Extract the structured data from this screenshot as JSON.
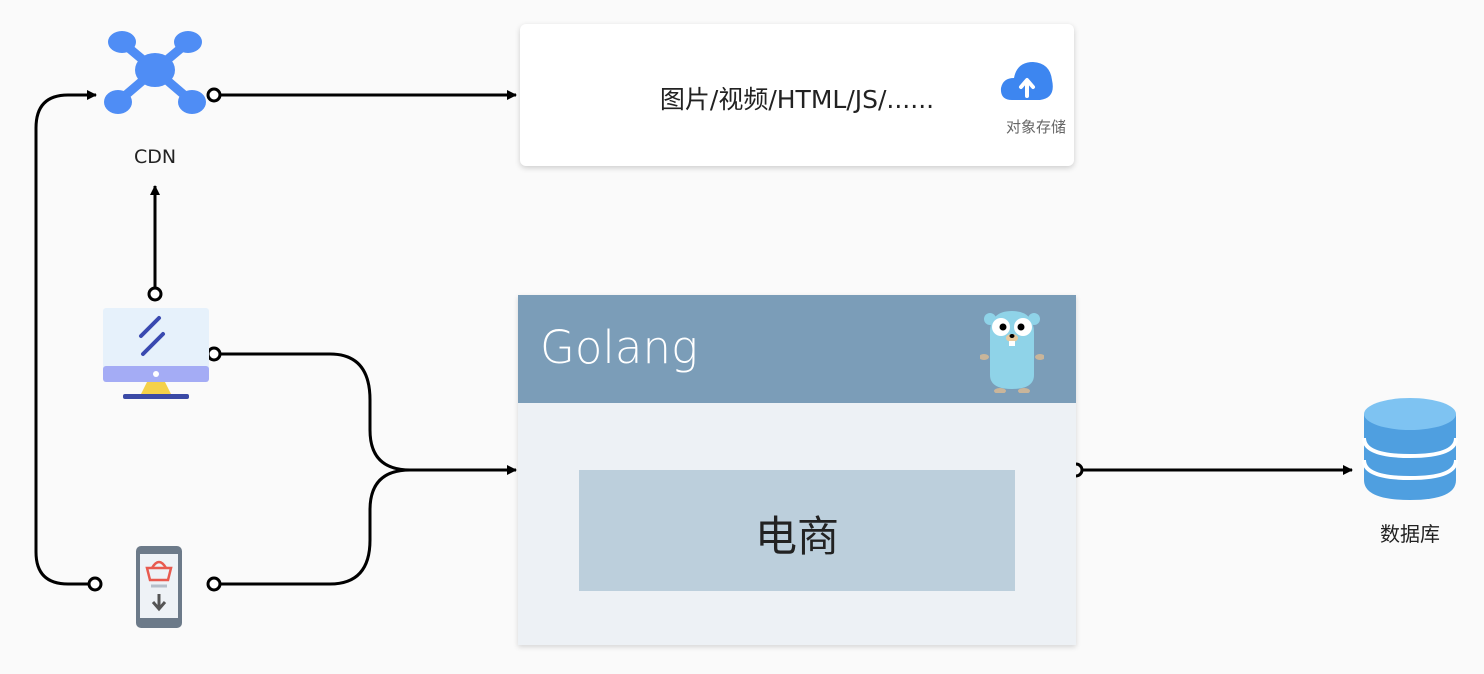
{
  "nodes": {
    "cdn": {
      "label": "CDN",
      "icon": "cdn-network-icon",
      "color": "#4f8df5"
    },
    "desktop": {
      "icon": "desktop-monitor-icon"
    },
    "mobile": {
      "icon": "mobile-shop-icon"
    },
    "storage": {
      "content": "图片/视频/HTML/JS/......",
      "caption": "对象存储",
      "icon": "cloud-upload-icon",
      "color": "#3d86f0"
    },
    "golang": {
      "title": "Golang",
      "mascot": "gopher-icon",
      "header_color": "#7b9db8"
    },
    "ecommerce": {
      "label": "电商",
      "color": "#bccfdc"
    },
    "database": {
      "label": "数据库",
      "icon": "database-icon",
      "color": "#5aa9e6"
    }
  },
  "edges": [
    {
      "from": "cdn",
      "to": "storage"
    },
    {
      "from": "desktop",
      "to": "cdn"
    },
    {
      "from": "mobile",
      "to": "cdn"
    },
    {
      "from": "desktop",
      "to": "golang"
    },
    {
      "from": "mobile",
      "to": "golang"
    },
    {
      "from": "golang",
      "to": "database"
    }
  ]
}
